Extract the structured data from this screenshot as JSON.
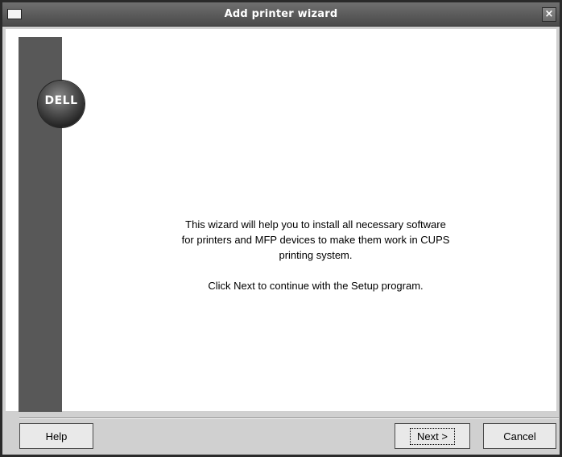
{
  "window": {
    "title": "Add printer wizard",
    "menu_icon": "window-menu-icon",
    "close_icon": "close-icon",
    "close_glyph": "×"
  },
  "logo": {
    "text": "DELL",
    "icon": "dell-logo"
  },
  "message": {
    "paragraph1": "This wizard will help you to install all necessary software for printers and MFP devices to make them work in CUPS printing system.",
    "paragraph2": "Click Next to continue with the Setup program."
  },
  "buttons": {
    "help_label": "Help",
    "next_label": "Next >",
    "cancel_label": "Cancel"
  },
  "colors": {
    "sidebar": "#585858",
    "titlebar": "#5a5a5a"
  }
}
